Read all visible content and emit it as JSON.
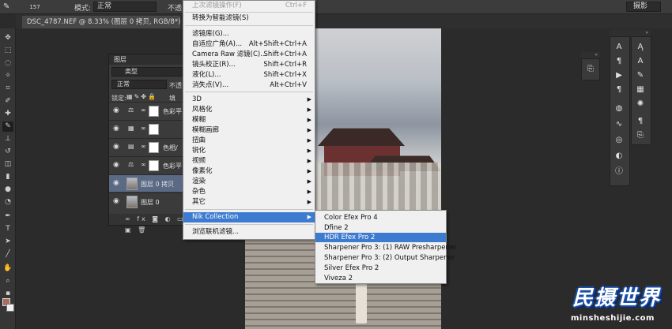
{
  "options_bar": {
    "brush_size": "157",
    "mode_label": "模式:",
    "mode_value": "正常",
    "opacity_label": "不透",
    "workspace": "摄影"
  },
  "document_tab": {
    "title": "DSC_4787.NEF @ 8.33% (图层 0 拷贝, RGB/8*) *"
  },
  "layers_panel": {
    "title": "图层",
    "filter_kind": "类型",
    "blend_mode": "正常",
    "opacity_label": "不透",
    "lock_label": "锁定:",
    "fill_label": "填",
    "layers": [
      {
        "name": "色彩平",
        "type": "adjustment",
        "active": false
      },
      {
        "name": "",
        "type": "adjustment",
        "active": false
      },
      {
        "name": "色相/",
        "type": "adjustment",
        "active": false
      },
      {
        "name": "色彩平",
        "type": "adjustment",
        "active": false
      },
      {
        "name": "图层 0 拷贝",
        "type": "pixel",
        "active": true
      },
      {
        "name": "图层 0",
        "type": "pixel",
        "active": false
      }
    ],
    "footer_icons": [
      "link-icon",
      "fx-icon",
      "mask-icon",
      "adjustment-icon",
      "folder-icon",
      "new-layer-icon",
      "trash-icon"
    ]
  },
  "filter_menu": {
    "items": [
      {
        "label": "上次滤镜操作(F)",
        "shortcut": "Ctrl+F",
        "disabled": true
      },
      {
        "label": "转换为智能滤镜(S)",
        "shortcut": ""
      },
      {
        "label": "滤镜库(G)...",
        "shortcut": ""
      },
      {
        "label": "自适应广角(A)...",
        "shortcut": "Alt+Shift+Ctrl+A"
      },
      {
        "label": "Camera Raw 滤镜(C)...",
        "shortcut": "Shift+Ctrl+A"
      },
      {
        "label": "镜头校正(R)...",
        "shortcut": "Shift+Ctrl+R"
      },
      {
        "label": "液化(L)...",
        "shortcut": "Shift+Ctrl+X"
      },
      {
        "label": "消失点(V)...",
        "shortcut": "Alt+Ctrl+V"
      },
      {
        "label": "3D",
        "submenu": true
      },
      {
        "label": "风格化",
        "submenu": true
      },
      {
        "label": "模糊",
        "submenu": true
      },
      {
        "label": "模糊画廊",
        "submenu": true
      },
      {
        "label": "扭曲",
        "submenu": true
      },
      {
        "label": "锐化",
        "submenu": true
      },
      {
        "label": "视频",
        "submenu": true
      },
      {
        "label": "像素化",
        "submenu": true
      },
      {
        "label": "渲染",
        "submenu": true
      },
      {
        "label": "杂色",
        "submenu": true
      },
      {
        "label": "其它",
        "submenu": true
      },
      {
        "label": "Nik Collection",
        "submenu": true,
        "highlighted": true
      },
      {
        "label": "浏览联机滤镜...",
        "shortcut": ""
      }
    ]
  },
  "nik_submenu": {
    "items": [
      {
        "label": "Color Efex Pro 4"
      },
      {
        "label": "Dfine 2"
      },
      {
        "label": "HDR Efex Pro 2",
        "highlighted": true
      },
      {
        "label": "Sharpener Pro 3: (1) RAW Presharpener"
      },
      {
        "label": "Sharpener Pro 3: (2) Output Sharpener"
      },
      {
        "label": "Silver Efex Pro 2"
      },
      {
        "label": "Viveza 2"
      }
    ]
  },
  "watermark": {
    "logo": "民摄世界",
    "url": "minsheshijie.com"
  },
  "colors": {
    "menu_highlight": "#3d7bd0",
    "foreground_swatch": "#a86e5d",
    "background_swatch": "#f0f0f0"
  }
}
